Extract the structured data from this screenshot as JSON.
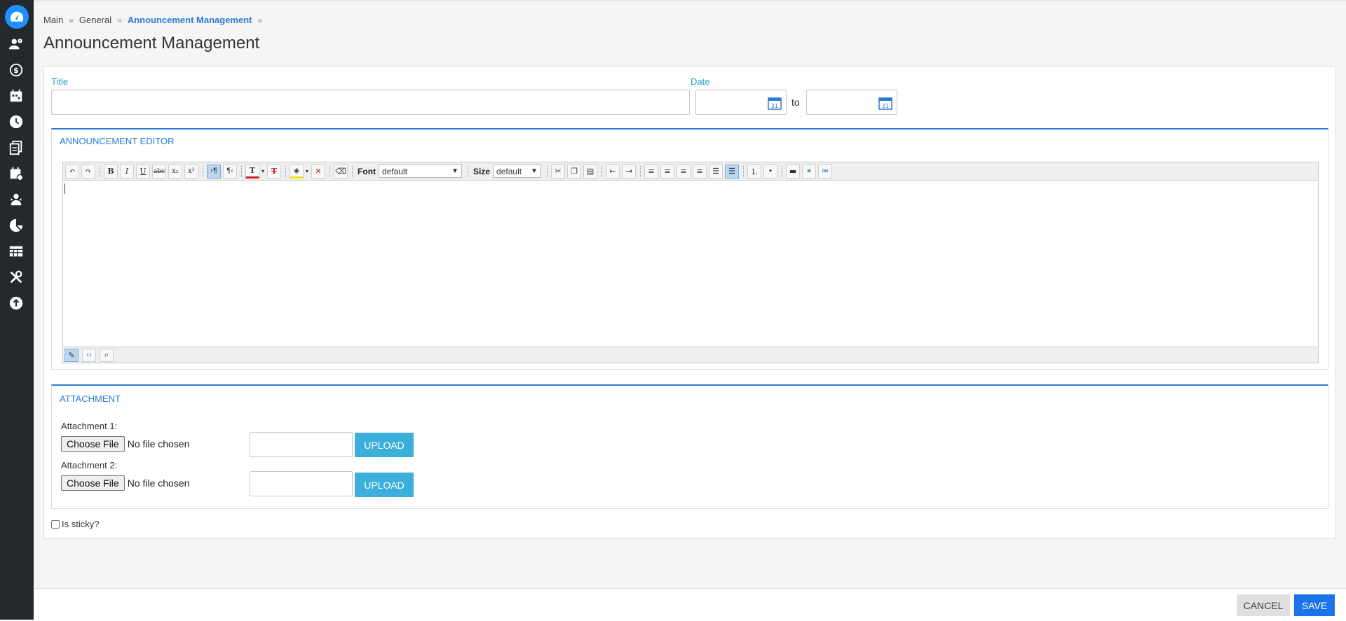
{
  "sidebar": {
    "items": [
      {
        "icon": "dashboard-icon",
        "active": true
      },
      {
        "icon": "people-icon"
      },
      {
        "icon": "payroll-icon"
      },
      {
        "icon": "calendar-icon"
      },
      {
        "icon": "clock-icon"
      },
      {
        "icon": "documents-icon"
      },
      {
        "icon": "leave-calendar-icon"
      },
      {
        "icon": "person-badge-icon"
      },
      {
        "icon": "pie-chart-icon"
      },
      {
        "icon": "table-icon"
      },
      {
        "icon": "tools-icon"
      },
      {
        "icon": "upload-icon"
      }
    ],
    "colors": {
      "background": "#24292e",
      "active": "#1e90ff"
    }
  },
  "breadcrumb": {
    "items": [
      "Main",
      "General",
      "Announcement Management"
    ],
    "separator": "»"
  },
  "page": {
    "title": "Announcement Management"
  },
  "form": {
    "title_label": "Title",
    "title_value": "",
    "date_label": "Date",
    "date_from": "",
    "date_to": "",
    "to_label": "to",
    "calendar_day": "31"
  },
  "editor": {
    "section_title": "ANNOUNCEMENT EDITOR",
    "font_label": "Font",
    "font_value": "default",
    "size_label": "Size",
    "size_value": "default",
    "content": ""
  },
  "attachment": {
    "section_title": "ATTACHMENT",
    "items": [
      {
        "label": "Attachment 1:",
        "choose": "Choose File",
        "status": "No file chosen",
        "upload": "UPLOAD"
      },
      {
        "label": "Attachment 2:",
        "choose": "Choose File",
        "status": "No file chosen",
        "upload": "UPLOAD"
      }
    ]
  },
  "sticky": {
    "label": "Is sticky?",
    "checked": false
  },
  "actions": {
    "cancel": "CANCEL",
    "save": "SAVE"
  },
  "colors": {
    "accent": "#2a7bd6",
    "upload": "#3cb0db",
    "save": "#1a73e8",
    "label": "#2a9fc9"
  }
}
